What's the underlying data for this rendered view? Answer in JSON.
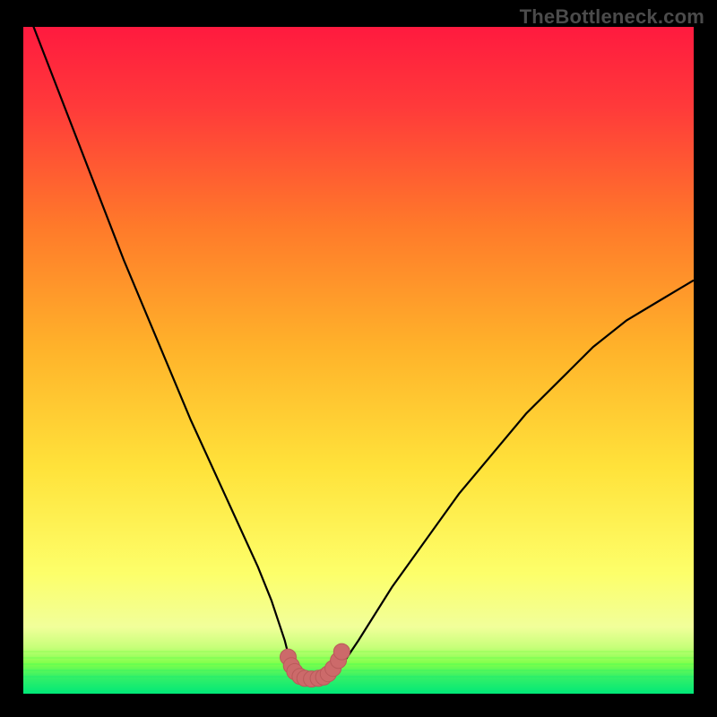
{
  "watermark": "TheBottleneck.com",
  "colors": {
    "frame_bg": "#000000",
    "gradient_top": "#ff1a3f",
    "gradient_mid1": "#ff9a1f",
    "gradient_mid2": "#ffe23a",
    "gradient_low": "#f8ff8a",
    "gradient_green_top": "#7fff4a",
    "gradient_green_bot": "#00e878",
    "curve": "#000000",
    "marker_fill": "#cc6a6a",
    "marker_stroke": "#b95a5a"
  },
  "chart_data": {
    "type": "line",
    "title": "",
    "xlabel": "",
    "ylabel": "",
    "xlim": [
      0,
      100
    ],
    "ylim": [
      0,
      100
    ],
    "x": [
      0,
      5,
      10,
      15,
      20,
      25,
      30,
      35,
      37,
      39,
      40,
      41,
      42,
      43,
      44,
      45,
      46,
      48,
      50,
      55,
      60,
      65,
      70,
      75,
      80,
      85,
      90,
      95,
      100
    ],
    "values": [
      104,
      91,
      78,
      65,
      53,
      41,
      30,
      19,
      14,
      8,
      4,
      2.5,
      2.2,
      2.2,
      2.2,
      2.5,
      3,
      5,
      8,
      16,
      23,
      30,
      36,
      42,
      47,
      52,
      56,
      59,
      62
    ],
    "series": [
      {
        "name": "bottleneck-curve",
        "x": [
          0,
          5,
          10,
          15,
          20,
          25,
          30,
          35,
          37,
          39,
          40,
          41,
          42,
          43,
          44,
          45,
          46,
          48,
          50,
          55,
          60,
          65,
          70,
          75,
          80,
          85,
          90,
          95,
          100
        ],
        "y": [
          104,
          91,
          78,
          65,
          53,
          41,
          30,
          19,
          14,
          8,
          4,
          2.5,
          2.2,
          2.2,
          2.2,
          2.5,
          3,
          5,
          8,
          16,
          23,
          30,
          36,
          42,
          47,
          52,
          56,
          59,
          62
        ]
      },
      {
        "name": "optimal-band-markers",
        "x": [
          39.5,
          40,
          40.5,
          41.3,
          42,
          43,
          44,
          44.8,
          45.5,
          46.2,
          47,
          47.5
        ],
        "y": [
          5.5,
          4.2,
          3.3,
          2.6,
          2.3,
          2.2,
          2.3,
          2.5,
          3.0,
          3.8,
          5.0,
          6.3
        ]
      }
    ],
    "annotations": []
  }
}
